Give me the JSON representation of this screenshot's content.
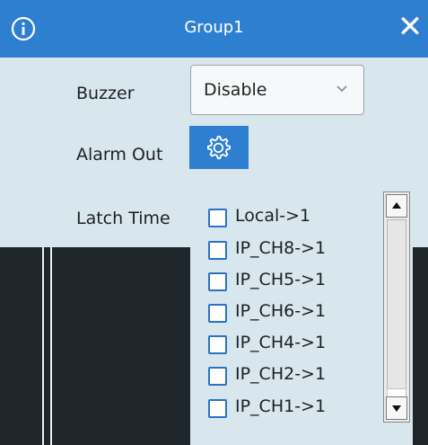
{
  "window": {
    "title": "Group1"
  },
  "fields": {
    "buzzer_label": "Buzzer",
    "buzzer_value": "Disable",
    "alarm_out_label": "Alarm Out",
    "latch_time_label": "Latch Time"
  },
  "channel_list": [
    {
      "label": "Local->1",
      "checked": false
    },
    {
      "label": "IP_CH8->1",
      "checked": false
    },
    {
      "label": "IP_CH5->1",
      "checked": false
    },
    {
      "label": "IP_CH6->1",
      "checked": false
    },
    {
      "label": "IP_CH4->1",
      "checked": false
    },
    {
      "label": "IP_CH2->1",
      "checked": false
    },
    {
      "label": "IP_CH1->1",
      "checked": false
    }
  ],
  "icons": {
    "info": "info-icon",
    "close": "close-icon",
    "settings": "gear-icon",
    "dropdown": "chevron-down-icon"
  },
  "colors": {
    "title_bar": "#2f7fd1",
    "panel": "#d8e6ed",
    "checkbox_border": "#2a72c8"
  }
}
